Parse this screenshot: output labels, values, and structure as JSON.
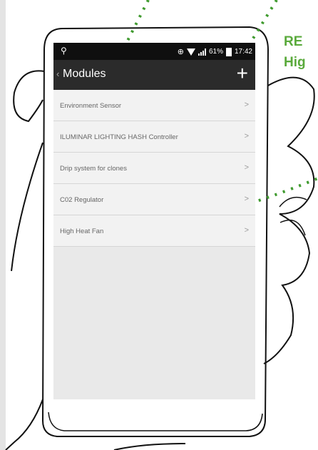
{
  "status_bar": {
    "usb_icon": "usb-icon",
    "battery_percent": "61%",
    "time": "17:42"
  },
  "app_bar": {
    "back_glyph": "‹",
    "title": "Modules",
    "add_glyph": "+"
  },
  "modules": [
    {
      "label": "Environment Sensor",
      "chevron": ">"
    },
    {
      "label": "ILUMINAR LIGHTING HASH Controller",
      "chevron": ">"
    },
    {
      "label": "Drip system for clones",
      "chevron": ">"
    },
    {
      "label": "C02 Regulator",
      "chevron": ">"
    },
    {
      "label": "High Heat Fan",
      "chevron": ">"
    }
  ],
  "caption": {
    "line1": "RE",
    "line2": "Hig"
  },
  "colors": {
    "accent_green": "#5aaa3c",
    "app_bar": "#2b2b2b",
    "status_bar": "#0f0f0f"
  }
}
